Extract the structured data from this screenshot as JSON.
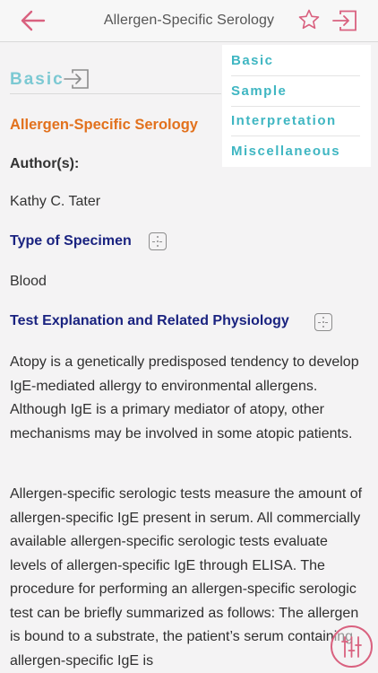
{
  "navbar": {
    "title": "Allergen-Specific Serology",
    "icons": {
      "back": "back-arrow-icon",
      "favorite": "star-icon",
      "exit": "exit-icon"
    }
  },
  "section": {
    "label": "Basic",
    "icon": "exit-icon"
  },
  "document": {
    "title": "Allergen-Specific Serology",
    "author_label": "Author(s):",
    "author": "Kathy C. Tater",
    "specimen_heading": "Type of Specimen",
    "specimen_value": "Blood",
    "explanation_heading": "Test Explanation and Related Physiology",
    "paragraphs": [
      "Atopy is a genetically predisposed tendency to develop IgE-mediated allergy to environmental allergens. Although IgE is a primary mediator of atopy, other mechanisms may be involved in some atopic patients.",
      "Allergen-specific serologic tests measure the amount of allergen-specific IgE present in serum. All commercially available allergen-specific serologic tests evaluate levels of allergen-specific IgE through ELISA. The procedure for performing an allergen-specific serologic test can be briefly summarized as follows: The allergen is bound to a substrate, the patient’s serum containing allergen-specific IgE is"
    ]
  },
  "section_menu": {
    "items": [
      "Basic",
      "Sample",
      "Interpretation",
      "Miscellaneous"
    ]
  },
  "colors": {
    "accent_pink": "#d9617f",
    "section_teal": "#7cc9d3",
    "menu_teal": "#3fb6c2",
    "title_orange": "#e2711d",
    "heading_navy": "#1a2380"
  },
  "fab": {
    "icon": "filter-sliders-icon"
  }
}
